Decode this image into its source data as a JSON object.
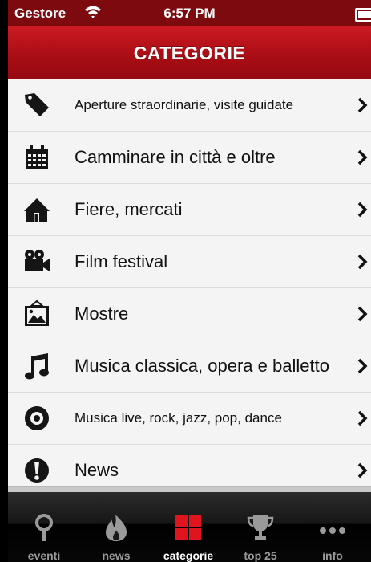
{
  "status": {
    "carrier": "Gestore",
    "time": "6:57 PM"
  },
  "nav": {
    "title": "CATEGORIE"
  },
  "categories": [
    {
      "label": "Aperture straordinarie, visite guidate",
      "icon": "tag-icon"
    },
    {
      "label": "Camminare in città e oltre",
      "icon": "calendar-icon"
    },
    {
      "label": "Fiere, mercati",
      "icon": "house-icon"
    },
    {
      "label": "Film festival",
      "icon": "video-camera-icon"
    },
    {
      "label": "Mostre",
      "icon": "picture-icon"
    },
    {
      "label": "Musica classica, opera e balletto",
      "icon": "music-note-icon"
    },
    {
      "label": "Musica live, rock, jazz, pop, dance",
      "icon": "vinyl-disc-icon"
    },
    {
      "label": "News",
      "icon": "exclamation-icon"
    }
  ],
  "tabs": [
    {
      "label": "eventi",
      "icon": "map-pin-icon"
    },
    {
      "label": "news",
      "icon": "flame-icon"
    },
    {
      "label": "categorie",
      "icon": "grid-icon",
      "active": true
    },
    {
      "label": "top 25",
      "icon": "trophy-icon"
    },
    {
      "label": "info",
      "icon": "more-dots-icon"
    }
  ],
  "colors": {
    "nav_red": "#b3121a",
    "status_red": "#7d0a0f",
    "active_tab_red": "#e0141f"
  }
}
